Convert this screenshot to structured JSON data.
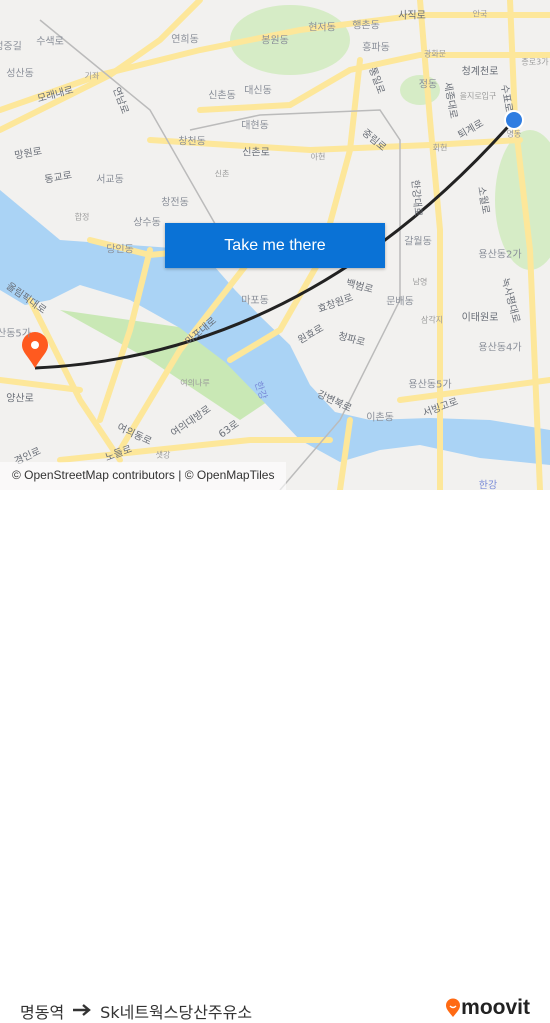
{
  "map": {
    "labels": [
      "수색로",
      "성중길",
      "성산동",
      "연희동",
      "봉원동",
      "현저동",
      "행촌동",
      "사직로",
      "흥파동",
      "광화문",
      "안국",
      "청계천로",
      "종로3가",
      "정동",
      "세종대로",
      "을지로입구",
      "수표로",
      "모래내로",
      "기좌",
      "연남로",
      "대신동",
      "신촌동",
      "대현동",
      "창천동",
      "신촌로",
      "아현",
      "중림로",
      "퇴계로",
      "회현",
      "망원로",
      "동교로",
      "서교동",
      "신촌",
      "창전동",
      "합정",
      "상수동",
      "당인동",
      "갈월동",
      "용산동2가",
      "백범로",
      "남영",
      "마포동",
      "효창원로",
      "문배동",
      "이태원로",
      "삼각지",
      "용산동4가",
      "원효로",
      "청파로",
      "올림픽대로",
      "산동5가",
      "양산로",
      "여의나루",
      "한강",
      "용산동5가",
      "강변북로",
      "이촌동",
      "서빙고로",
      "여의대방로",
      "63로",
      "여의동로",
      "노들로",
      "샛강",
      "경인로",
      "녹사평대로",
      "한강대로",
      "마포대로",
      "통일로",
      "소월로",
      "명동",
      "한강"
    ],
    "water_color": "#aad3f5",
    "park_color": "#c9e8b5",
    "road_color": "#fde79a",
    "route_color": "#222222",
    "origin_marker_color": "#2f7de1",
    "destination_marker_color": "#ff5a1f",
    "origin_icon": "current-location-dot",
    "destination_icon": "map-pin-icon"
  },
  "cta": {
    "label": "Take me there"
  },
  "attribution": "© OpenStreetMap contributors | © OpenMapTiles",
  "footer": {
    "origin": "명동역",
    "arrow_icon": "arrow-right-icon",
    "destination": "Sk네트웍스당산주유소",
    "logo_text": "moovit",
    "brand_color": "#ff6a13"
  }
}
